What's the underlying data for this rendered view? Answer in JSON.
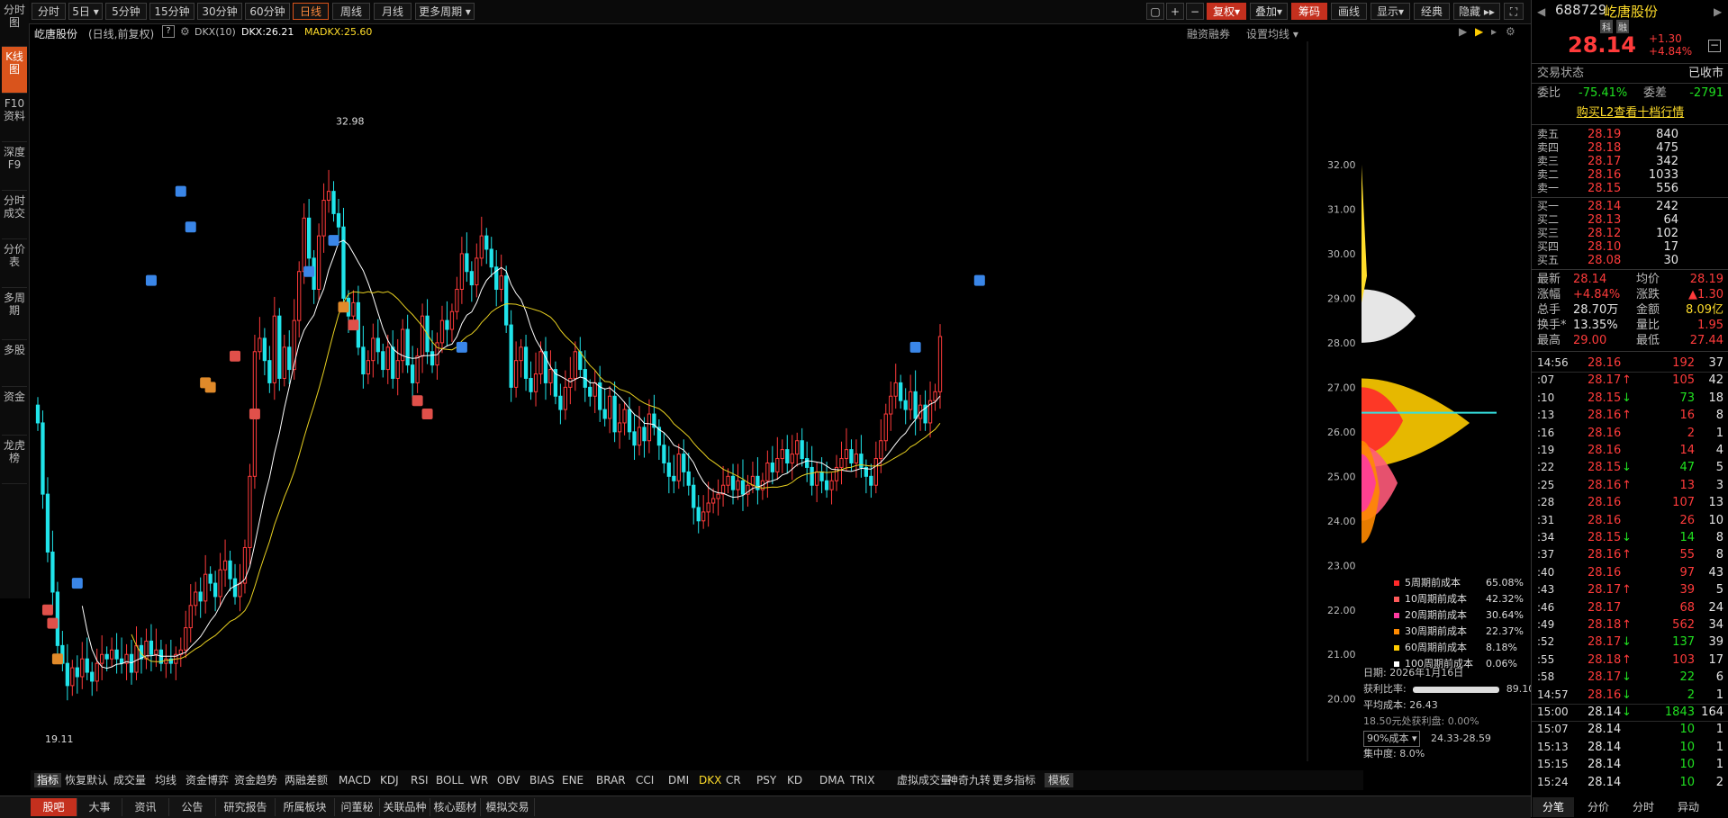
{
  "stock": {
    "code": "688729",
    "name": "屹唐股份",
    "tag1": "科",
    "tag2": "融",
    "price": "28.14",
    "change": "+1.30",
    "change_pct": "+4.84%"
  },
  "toolbar": {
    "tabs": [
      "分时",
      "5日",
      "5分钟",
      "15分钟",
      "30分钟",
      "60分钟",
      "日线",
      "周线",
      "月线",
      "更多周期"
    ],
    "active": "日线",
    "right": [
      "复权",
      "叠加",
      "筹码",
      "画线",
      "显示",
      "经典",
      "隐藏"
    ]
  },
  "leftnav": [
    "分时图",
    "K线图",
    "F10资料",
    "深度F9",
    "分时成交",
    "分价表",
    "多周期",
    "多股",
    "资金",
    "龙虎榜"
  ],
  "infobar": {
    "title": "屹唐股份",
    "sub": "(日线,前复权)",
    "dkx": "DKX(10)",
    "dkx_val": "DKX:26.21",
    "madkx": "MADKX:25.60",
    "rzrq": "融资融券",
    "setma": "设置均线"
  },
  "axis": {
    "labels": [
      "32.00",
      "31.00",
      "30.00",
      "29.00",
      "28.00",
      "27.00",
      "26.00",
      "25.00",
      "24.00",
      "23.00",
      "22.00",
      "21.00",
      "20.00"
    ],
    "high_label": "32.98",
    "low_label": "19.11"
  },
  "cost_legend": [
    {
      "label": "5周期前成本",
      "value": "65.08%",
      "color": "#ff2a2a"
    },
    {
      "label": "10周期前成本",
      "value": "42.32%",
      "color": "#ff5a5a"
    },
    {
      "label": "20周期前成本",
      "value": "30.64%",
      "color": "#ff3aa0"
    },
    {
      "label": "30周期前成本",
      "value": "22.37%",
      "color": "#ff8a00"
    },
    {
      "label": "60周期前成本",
      "value": "8.18%",
      "color": "#ffcc00"
    },
    {
      "label": "100周期前成本",
      "value": "0.06%",
      "color": "#ffffff"
    }
  ],
  "cost_info": {
    "date": "日期: 2026年1月16日",
    "profit_label": "获利比率:",
    "profit_value": "89.10%",
    "avg_cost": "平均成本: 26.43",
    "profit_at": "18.50元处获利盘: 0.00%",
    "range_select": "90%成本",
    "range": "24.33-28.59",
    "concentration": "集中度: 8.0%"
  },
  "indicators": [
    "指标",
    "恢复默认",
    "成交量",
    "均线",
    "资金博弈",
    "资金趋势",
    "两融差额",
    "MACD",
    "KDJ",
    "RSI",
    "BOLL",
    "WR",
    "OBV",
    "BIAS",
    "ENE",
    "BRAR",
    "CCI",
    "DMI",
    "DKX",
    "CR",
    "PSY",
    "KD",
    "DMA",
    "TRIX",
    "虚拟成交量",
    "神奇九转",
    "更多指标",
    "模板"
  ],
  "bottom_tabs": [
    "股吧",
    "大事",
    "资讯",
    "公告",
    "研究报告",
    "所属板块",
    "问董秘",
    "关联品种",
    "核心题材",
    "模拟交易"
  ],
  "right": {
    "status_label": "交易状态",
    "status": "已收市",
    "wb_label": "委比",
    "wb": "-75.41%",
    "wc_label": "委差",
    "wc": "-2791",
    "l2": "购买L2查看十档行情",
    "sells": [
      [
        "卖五",
        "28.19",
        "840"
      ],
      [
        "卖四",
        "28.18",
        "475"
      ],
      [
        "卖三",
        "28.17",
        "342"
      ],
      [
        "卖二",
        "28.16",
        "1033"
      ],
      [
        "卖一",
        "28.15",
        "556"
      ]
    ],
    "buys": [
      [
        "买一",
        "28.14",
        "242"
      ],
      [
        "买二",
        "28.13",
        "64"
      ],
      [
        "买三",
        "28.12",
        "102"
      ],
      [
        "买四",
        "28.10",
        "17"
      ],
      [
        "买五",
        "28.08",
        "30"
      ]
    ],
    "stats": [
      [
        "最新",
        "28.14",
        "均价",
        "28.19"
      ],
      [
        "涨幅",
        "+4.84%",
        "涨跌",
        "▲1.30"
      ],
      [
        "总手",
        "28.70万",
        "金额",
        "8.09亿"
      ],
      [
        "换手*",
        "13.35%",
        "量比",
        "1.95"
      ],
      [
        "最高",
        "29.00",
        "最低",
        "27.44"
      ]
    ],
    "ticks": [
      [
        "14:56",
        "28.16",
        "",
        "192",
        "37"
      ],
      [
        ":07",
        "28.17",
        "↑",
        "105",
        "42"
      ],
      [
        ":10",
        "28.15",
        "↓",
        "73",
        "18"
      ],
      [
        ":13",
        "28.16",
        "↑",
        "16",
        "8"
      ],
      [
        ":16",
        "28.16",
        "",
        "2",
        "1"
      ],
      [
        ":19",
        "28.16",
        "",
        "14",
        "4"
      ],
      [
        ":22",
        "28.15",
        "↓",
        "47",
        "5"
      ],
      [
        ":25",
        "28.16",
        "↑",
        "13",
        "3"
      ],
      [
        ":28",
        "28.16",
        "",
        "107",
        "13"
      ],
      [
        ":31",
        "28.16",
        "",
        "26",
        "10"
      ],
      [
        ":34",
        "28.15",
        "↓",
        "14",
        "8"
      ],
      [
        ":37",
        "28.16",
        "↑",
        "55",
        "8"
      ],
      [
        ":40",
        "28.16",
        "",
        "97",
        "43"
      ],
      [
        ":43",
        "28.17",
        "↑",
        "39",
        "5"
      ],
      [
        ":46",
        "28.17",
        "",
        "68",
        "24"
      ],
      [
        ":49",
        "28.18",
        "↑",
        "562",
        "34"
      ],
      [
        ":52",
        "28.17",
        "↓",
        "137",
        "39"
      ],
      [
        ":55",
        "28.18",
        "↑",
        "103",
        "17"
      ],
      [
        ":58",
        "28.17",
        "↓",
        "22",
        "6"
      ],
      [
        "14:57",
        "28.16",
        "↓",
        "2",
        "1"
      ],
      [
        "15:00",
        "28.14",
        "↓",
        "1843",
        "164"
      ],
      [
        "15:07",
        "28.14",
        "",
        "10",
        "1"
      ],
      [
        "15:13",
        "28.14",
        "",
        "10",
        "1"
      ],
      [
        "15:15",
        "28.14",
        "",
        "10",
        "1"
      ],
      [
        "15:24",
        "28.14",
        "",
        "10",
        "2"
      ]
    ],
    "tabs": [
      "分笔",
      "分价",
      "分时",
      "异动"
    ]
  }
}
